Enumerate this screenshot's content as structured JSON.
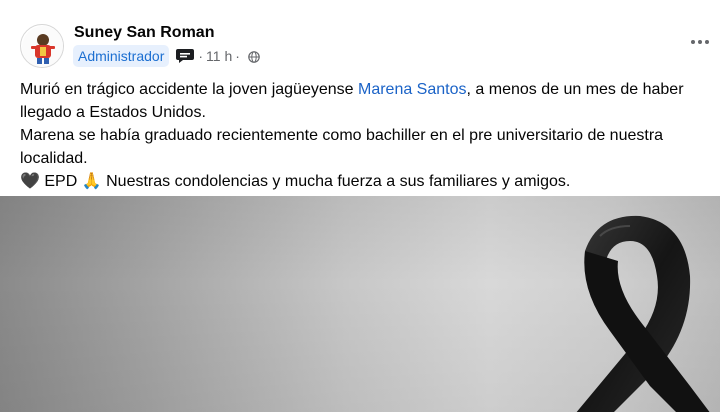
{
  "post": {
    "author": "Suney San Roman",
    "role_badge": "Administrador",
    "time": "11 h",
    "dot": "·",
    "text": {
      "line1_before": "Murió en trágico accidente la joven jagüeyense ",
      "mention": "Marena Santos",
      "line1_after": ", a menos de un mes de haber llegado a Estados Unidos.",
      "line2": "Marena se había graduado recientemente como bachiller en el pre universitario de nuestra localidad.",
      "line3_emoji_heart": "🖤",
      "line3_epd": "EPD",
      "line3_emoji_pray": "🙏",
      "line3_rest": "Nuestras condolencias y mucha fuerza a sus familiares y amigos."
    }
  },
  "icons": {
    "avatar": "profile-avatar",
    "badge": "chat-bubble-icon",
    "privacy": "globe-icon",
    "menu": "more-options-icon",
    "ribbon": "black-mourning-ribbon"
  },
  "colors": {
    "mention": "#1b63c7",
    "badge_bg": "#e7f0fd",
    "badge_text": "#1c6fd1",
    "meta_text": "#65676b"
  }
}
